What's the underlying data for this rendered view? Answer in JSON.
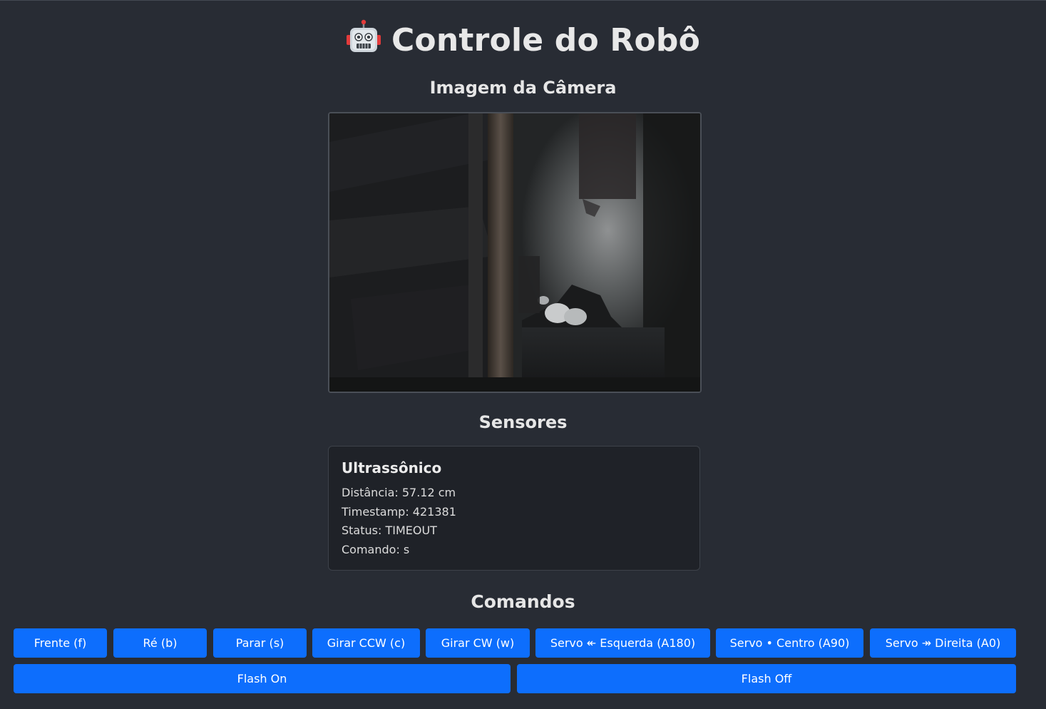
{
  "header": {
    "icon": "robot-icon",
    "title": "Controle do Robô"
  },
  "camera": {
    "heading": "Imagem da Câmera"
  },
  "sensors": {
    "heading": "Sensores",
    "card": {
      "title": "Ultrassônico",
      "distance": "Distância: 57.12 cm",
      "timestamp": "Timestamp: 421381",
      "status": "Status: TIMEOUT",
      "command": "Comando: s"
    }
  },
  "commands": {
    "heading": "Comandos",
    "buttons": [
      "Frente (f)",
      "Ré (b)",
      "Parar (s)",
      "Girar CCW (c)",
      "Girar CW (w)",
      "Servo ↞ Esquerda (A180)",
      "Servo • Centro (A90)",
      "Servo ↠ Direita (A0)"
    ],
    "flash_on": "Flash On",
    "flash_off": "Flash Off"
  },
  "colors": {
    "background": "#282c34",
    "button": "#0d6efd",
    "card": "#1f2228"
  }
}
